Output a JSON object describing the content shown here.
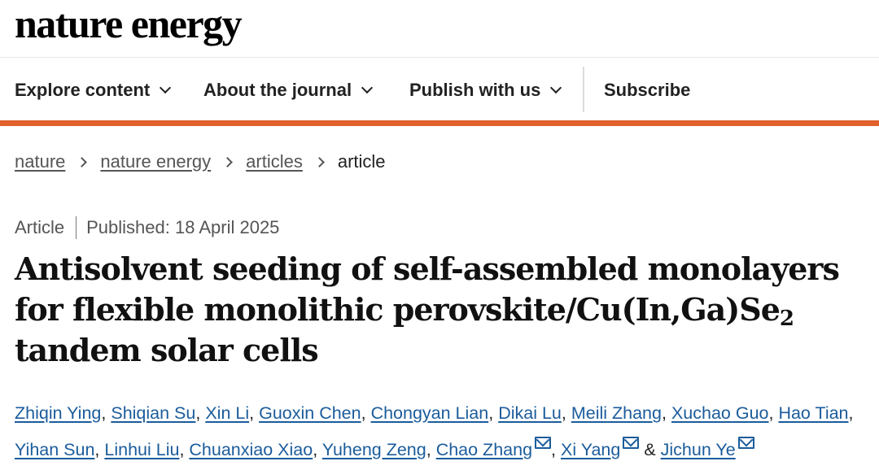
{
  "header": {
    "logo": "nature energy"
  },
  "nav": {
    "items": [
      {
        "label": "Explore content"
      },
      {
        "label": "About the journal"
      },
      {
        "label": "Publish with us"
      }
    ],
    "subscribe": "Subscribe"
  },
  "colors": {
    "accent": "#e0612b",
    "link": "#1b5c9c"
  },
  "breadcrumb": [
    "nature",
    "nature energy",
    "articles",
    "article"
  ],
  "article": {
    "type": "Article",
    "published": "Published: 18 April 2025",
    "title_part1": "Antisolvent seeding of self-assembled monolayers for flexible monolithic perovskite/Cu(In,Ga)Se",
    "title_sub": "2",
    "title_part2": " tandem solar cells"
  },
  "authors": [
    "Zhiqin Ying",
    "Shiqian Su",
    "Xin Li",
    "Guoxin Chen",
    "Chongyan Lian",
    "Dikai Lu",
    "Meili Zhang",
    "Xuchao Guo",
    "Hao Tian",
    "Yihan Sun",
    "Linhui Liu",
    "Chuanxiao Xiao",
    "Yuheng Zeng",
    "Chao Zhang",
    "Xi Yang",
    "Jichun Ye"
  ],
  "author_separator": ",",
  "author_final_conjunction": "&"
}
